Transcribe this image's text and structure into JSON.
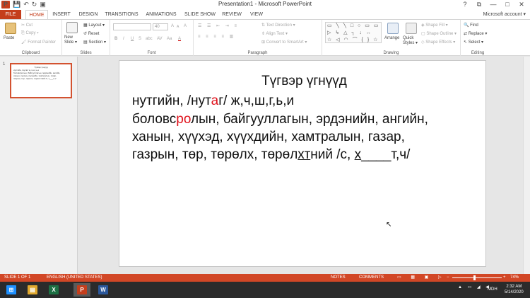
{
  "window": {
    "title": "Presentation1 - Microsoft PowerPoint",
    "controls": {
      "help": "?",
      "restore": "⧉",
      "minimize": "—",
      "maximize": "□",
      "close": "✕"
    }
  },
  "quick_access": {
    "logo": "P",
    "save": "💾",
    "undo": "↶",
    "redo": "↻",
    "start": "▣"
  },
  "tabs": [
    "FILE",
    "HOME",
    "INSERT",
    "DESIGN",
    "TRANSITIONS",
    "ANIMATIONS",
    "SLIDE SHOW",
    "REVIEW",
    "VIEW"
  ],
  "active_tab": "HOME",
  "account": "Microsoft account ▾",
  "ribbon": {
    "clipboard": {
      "label": "Clipboard",
      "paste": "Paste",
      "cut": "Cut",
      "copy": "Copy ▾",
      "format_painter": "Format Painter"
    },
    "slides": {
      "label": "Slides",
      "new_slide": "New Slide ▾",
      "layout": "Layout ▾",
      "reset": "Reset",
      "section": "Section ▾"
    },
    "font": {
      "label": "Font",
      "size": "40",
      "grow": "A",
      "shrink": "A",
      "clear": "A",
      "bold": "B",
      "italic": "I",
      "underline": "U",
      "strike": "S",
      "shadow": "abc",
      "spacing": "AV",
      "case": "Aa",
      "color": "A"
    },
    "paragraph": {
      "label": "Paragraph",
      "text_direction": "Text Direction ▾",
      "align_text": "Align Text ▾",
      "smartart": "Convert to SmartArt ▾"
    },
    "drawing": {
      "label": "Drawing",
      "shapes_glyphs": "▭ ╲ ╲ □ ○ ▭ ▭ ▷ ↳ △ ┐ ↓ ↔ ☆ ◁ ◠ ⌒ { } ☆",
      "arrange": "Arrange",
      "quick_styles": "Quick Styles ▾",
      "shape_fill": "Shape Fill ▾",
      "shape_outline": "Shape Outline ▾",
      "shape_effects": "Shape Effects ▾"
    },
    "editing": {
      "label": "Editing",
      "find": "Find",
      "replace": "Replace ▾",
      "select": "Select ▾"
    }
  },
  "thumbnail": {
    "number": "1",
    "lines": [
      "Түгвэр үгнүүд",
      "нутгийн, /нутаг/ ж,ч,ш,г,ь,и",
      "боловсролын, байгууллагын, эрдэнийн, ангийн,",
      "ханын, хүүхэд, хүүхдийн, хамтралын, газар,",
      "газрын, төр, төрөлх, төрөлхтний /с, х___т,ч/"
    ]
  },
  "slide": {
    "title": "Түгвэр үгнүүд",
    "line1": {
      "a": "нутгийн, /нут",
      "b": "а",
      "c": "г/ ж,ч,ш,г,ь,и"
    },
    "line2": {
      "a": "боловс",
      "b": "ро",
      "c": "лын,  байгууллагын,  эрдэнийн,  ангийн,"
    },
    "line3": "ханын,  хүүхэд,  хүүхдийн,  хамтралын,  газар,",
    "line4": {
      "a": "газрын, төр, төрөлх, төрөл",
      "b": "хт",
      "c": "ний  /с, ",
      "d": "х",
      "e": "____",
      "f": "т,ч/"
    },
    "cursor": "↖"
  },
  "status": {
    "slide": "SLIDE 1 OF 1",
    "lang": "ENGLISH (UNITED STATES)",
    "notes": "NOTES",
    "comments": "COMMENTS",
    "zoom": "74%",
    "minus": "−",
    "plus": "+"
  },
  "taskbar": {
    "apps": [
      {
        "name": "start",
        "glyph": "⊞",
        "color": "#1e90ff"
      },
      {
        "name": "explorer",
        "glyph": "▤",
        "color": "#e0a82e"
      },
      {
        "name": "excel",
        "glyph": "X",
        "color": "#1d7044"
      },
      {
        "name": "powerpoint",
        "glyph": "P",
        "color": "#c43e1c"
      },
      {
        "name": "word",
        "glyph": "W",
        "color": "#2b579a"
      }
    ],
    "ime": "MDH",
    "time": "2:32 AM",
    "date": "5/14/2020"
  }
}
